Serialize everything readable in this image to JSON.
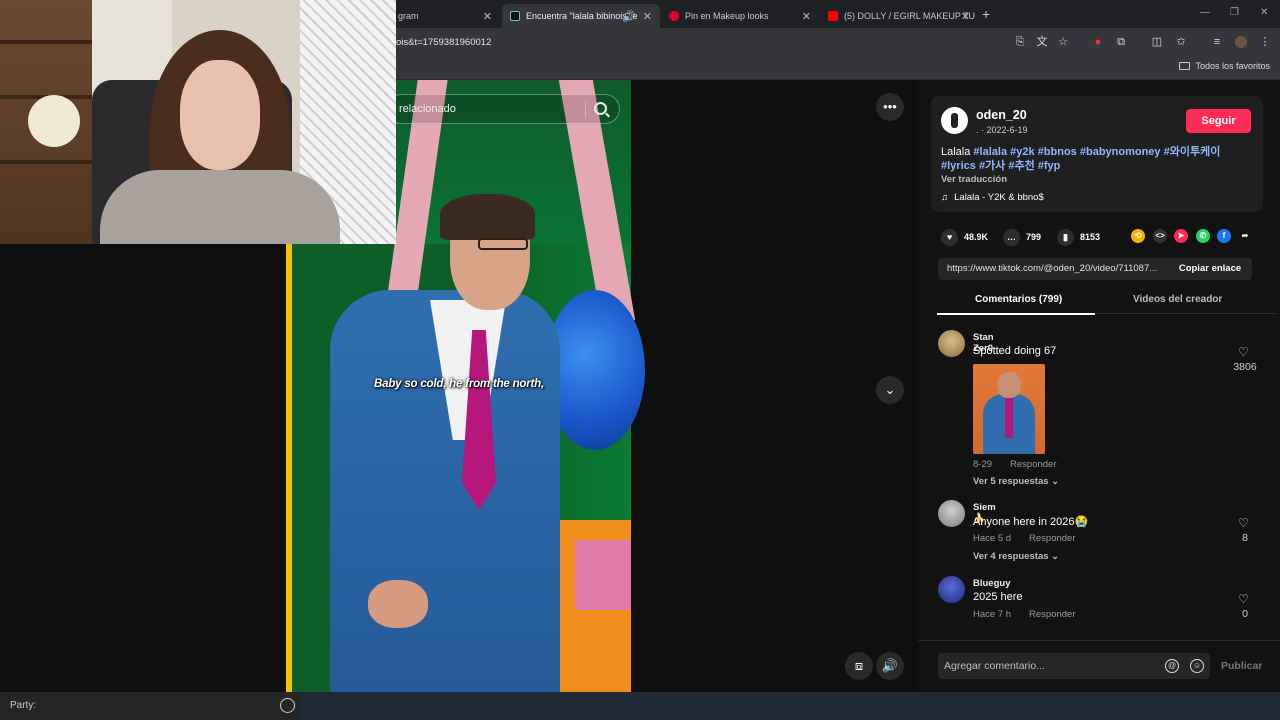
{
  "browser": {
    "tabs": [
      {
        "label": "gram",
        "active": false
      },
      {
        "label": "Encuentra \"lalala bibinois\" e",
        "active": true
      },
      {
        "label": "Pin en Makeup looks",
        "active": false
      },
      {
        "label": "(5) DOLLY / EGIRL MAKEUP TU",
        "active": false
      }
    ],
    "url_fragment": "ois&t=1759381960012",
    "bookmarks_label": "Todos los favoritos"
  },
  "video": {
    "search_placeholder": "relacionado",
    "caption": "Baby so cold, he from the north,"
  },
  "post": {
    "username": "oden_20",
    "date": ". · 2022-6-19",
    "follow_label": "Seguir",
    "description_plain": "Lalala ",
    "hashtags_line1": [
      "#lalala",
      "#y2k",
      "#bbnos",
      "#babynomoney",
      "#와이투케이"
    ],
    "hashtags_line2": [
      "#lyrics",
      "#가사",
      "#추천",
      "#fyp"
    ],
    "translate_label": "Ver traducción",
    "music": "Lalala - Y2K & bbno$",
    "likes": "48.9K",
    "comments": "799",
    "saves": "8153",
    "link": "https://www.tiktok.com/@oden_20/video/711087...",
    "copy_label": "Copiar enlace"
  },
  "tabs": {
    "comments": "Comentarios (799)",
    "creator_videos": "Videos del creador"
  },
  "comments": [
    {
      "name": "Stan Zer0",
      "text": "Spotted doing 67",
      "date": "8-29",
      "reply": "Responder",
      "likes": "3806",
      "replies": "Ver 5 respuestas"
    },
    {
      "name": "Siem🍌",
      "text": "Anyone here in 2026😭",
      "date": "Hace 5 d",
      "reply": "Responder",
      "likes": "8",
      "replies": "Ver 4 respuestas"
    },
    {
      "name": "Blueguy",
      "text": "2025 here",
      "date": "Hace 7 h",
      "reply": "Responder",
      "likes": "0"
    }
  ],
  "composer": {
    "placeholder": "Agregar comentario...",
    "publish_label": "Publicar"
  },
  "party": {
    "label": "Party:"
  },
  "colors": {
    "follow": "#fe2c55",
    "hashtag": "#8fb8ff"
  }
}
